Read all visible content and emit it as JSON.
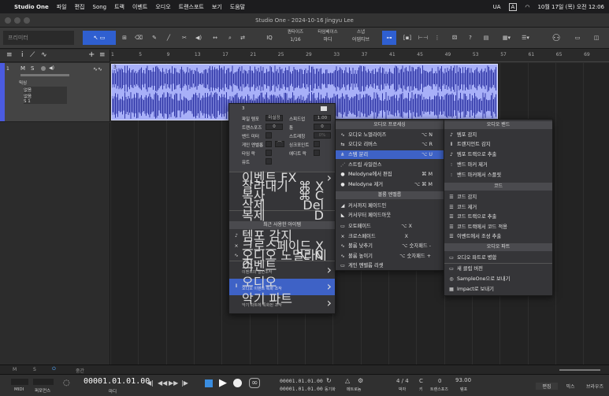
{
  "mac": {
    "app": "Studio One",
    "menus": [
      "파일",
      "편집",
      "Song",
      "트랙",
      "이벤트",
      "오디오",
      "트랜스포트",
      "보기",
      "도움말"
    ],
    "ua": "UA",
    "a": "A",
    "clock": "10월 17일 (목) 오전 12:06"
  },
  "window": {
    "title": "Studio One - 2024-10-16 Jingyu Lee"
  },
  "toolbar": {
    "preset": "프리미터",
    "q_label": "IQ",
    "quant_label": "퀀타이즈",
    "quant_value": "1/16",
    "timebase_label": "타임베이스",
    "timebase_value": "마디",
    "snap_label": "스냅",
    "snap_value": "어댑티브"
  },
  "ruler": {
    "marks": [
      "1",
      "5",
      "9",
      "13",
      "17",
      "21",
      "25",
      "29",
      "33",
      "37",
      "41",
      "45",
      "49",
      "53",
      "57",
      "61",
      "65",
      "69"
    ]
  },
  "track": {
    "number": "1",
    "m": "M",
    "s": "S",
    "mode": "믹싱",
    "input": "없음",
    "output": "없음",
    "channel": "S 1"
  },
  "event": {
    "number": "3"
  },
  "inspector": {
    "number": "3",
    "file_tempo_label": "파일 템포",
    "file_tempo_value": "미설정",
    "speedup_label": "스피드업",
    "speedup_value": "1.00",
    "transpose_label": "트랜스포즈",
    "transpose_value": "0",
    "tune_label": "튠",
    "tune_value": "0",
    "band_label": "밴드 미터",
    "stretch_label": "스트레칭",
    "stretch_value": "0%",
    "gain_label": "게인 엔벨롭",
    "sync_label": "싱크포인트",
    "timing_label": "타임 락",
    "edit_label": "에디트 락",
    "mute_label": "뮤트"
  },
  "context": {
    "items": [
      {
        "label": "이벤트 FX",
        "arrow": "›"
      },
      {
        "label": "잘라내기",
        "shortcut": "⌘ X"
      },
      {
        "label": "복사",
        "shortcut": "⌘ C"
      },
      {
        "label": "삭제",
        "shortcut": "Del"
      },
      {
        "label": "복제",
        "shortcut": "D"
      }
    ],
    "recent_header": "최근 사용한 아이템",
    "recent": [
      {
        "label": "템포 감지",
        "icon": "♪"
      },
      {
        "label": "크로스페이드",
        "shortcut": "X",
        "icon": "⨯"
      },
      {
        "label": "오디오 노멀라이즈",
        "shortcut": "⌥ N",
        "icon": "∿"
      }
    ],
    "groups": [
      {
        "label": "이벤트",
        "sub": "이벤트의 일반조작"
      },
      {
        "label": "오디오",
        "sub": "오디오 이벤트 특화 조작"
      },
      {
        "label": "악기 파트",
        "sub": "악기 파트에 특화된 조작"
      }
    ]
  },
  "audio_menu": {
    "header1": "오디오 프로세싱",
    "items1": [
      {
        "label": "오디오 노멀라이즈",
        "shortcut": "⌥ N"
      },
      {
        "label": "오디오 리버스",
        "shortcut": "⌥ R"
      },
      {
        "label": "스템 분리",
        "shortcut": "⌥ U"
      },
      {
        "label": "스트립 사일런스"
      },
      {
        "label": "Melodyne에서 편집",
        "shortcut": "⌘ M"
      },
      {
        "label": "Melodyne 제거",
        "shortcut": "⌥ ⌘ M"
      }
    ],
    "header2": "볼륨 엔벨롭",
    "items2": [
      {
        "label": "커서까지 페이드인"
      },
      {
        "label": "커서부터 페이드아웃"
      },
      {
        "label": "오토페이드",
        "shortcut": "⌥ X"
      },
      {
        "label": "크로스페이드",
        "shortcut": "X"
      },
      {
        "label": "볼륨 낮추기",
        "shortcut": "⌥ 숫자패드 -"
      },
      {
        "label": "볼륨 높이기",
        "shortcut": "⌥ 숫자패드 +"
      },
      {
        "label": "게인 엔벨롭 리셋"
      }
    ]
  },
  "right_menu": {
    "header1": "오디오 밴드",
    "items1": [
      "템포 감지",
      "트랜지언트 감지",
      "템포 트랙으로 추출",
      "밴드 마커 제거",
      "밴드 마커에서 스플릿"
    ],
    "header2": "코드",
    "items2": [
      "코드 감지",
      "코드 제거",
      "코드 트랙으로 추출",
      "코드 트랙에서 코드 적용",
      "이벤트에서 조성 추출"
    ],
    "header3": "오디오 파트",
    "items3": [
      "오디오 파트로 병합",
      "새 클립 버전",
      "SampleOne으로 보내기",
      "Impact로 보내기"
    ]
  },
  "status": {
    "m": "M",
    "s": "S",
    "mid": "중간"
  },
  "transport": {
    "midi": "MIDI",
    "perf": "퍼포먼스",
    "position": "00001.01.01.00",
    "pos_unit": "마디",
    "loop_start": "00001.01.01.00",
    "loop_end": "00001.01.01.00",
    "sync": "동기화",
    "metro": "메트로놈",
    "timesig": "4 / 4",
    "timesig_label": "박자",
    "key": "C",
    "key_label": "키",
    "transpose": "0",
    "transpose_label": "트랜스포즈",
    "tempo": "93.00",
    "tempo_label": "템포",
    "edit": "편집",
    "mix": "믹스",
    "browse": "브라우즈"
  }
}
